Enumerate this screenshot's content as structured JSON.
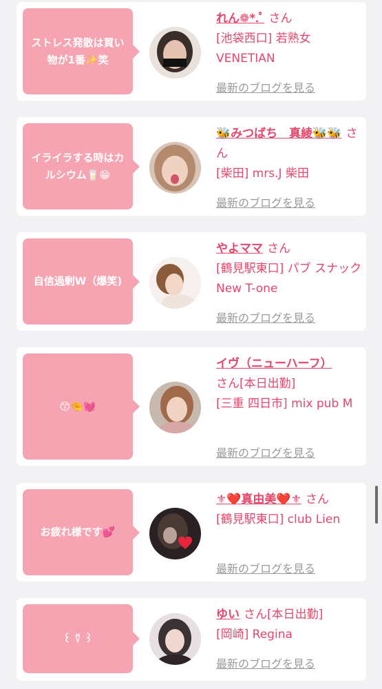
{
  "posts": [
    {
      "bubble": "ストレス発散は買い物が1番✨笑",
      "name": "れん❁*.ﾟ",
      "honorific": "さん",
      "shop": "[池袋西口] 若熟女VENETIAN",
      "blog_link": "最新のブログを見る"
    },
    {
      "bubble": "イライラする時はカルシウム🥛😁",
      "name": "🐝みつばち　真綾🐝🐝",
      "honorific": "さん",
      "shop": "[柴田] mrs.J 柴田",
      "blog_link": "最新のブログを見る"
    },
    {
      "bubble": "自信過剰W（爆笑)",
      "name": "やよママ",
      "honorific": "さん",
      "shop": "[鶴見駅東口] パブ スナック New T-one",
      "blog_link": "最新のブログを見る"
    },
    {
      "bubble": "😙🤏💓",
      "name": "イヴ（ニューハーフ）",
      "honorific": "さん[本日出勤]",
      "shop": "[三重 四日市] mix pub M",
      "blog_link": "最新のブログを見る"
    },
    {
      "bubble": "お疲れ様です💕",
      "name": "⚜❤️真由美❤️⚜",
      "honorific": "さん",
      "shop": "[鶴見駅東口] club Lien",
      "blog_link": "最新のブログを見る"
    },
    {
      "bubble": "꒰ ⍢ ꒱",
      "name": "ゆい",
      "honorific": "さん[本日出勤]",
      "shop": "[岡崎] Regina",
      "blog_link": "最新のブログを見る"
    }
  ],
  "colors": {
    "bubble": "#f7a4b2",
    "accent": "#e5466c",
    "muted": "#9a9a9a",
    "background": "#f2f2f4"
  }
}
